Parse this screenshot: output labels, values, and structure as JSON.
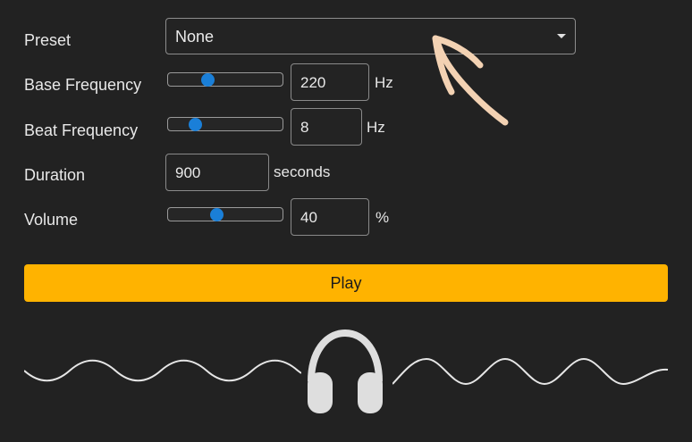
{
  "form": {
    "preset": {
      "label": "Preset",
      "value": "None"
    },
    "base_frequency": {
      "label": "Base Frequency",
      "value": "220",
      "unit": "Hz",
      "slider_fraction": 0.33
    },
    "beat_frequency": {
      "label": "Beat Frequency",
      "value": "8",
      "unit": "Hz",
      "slider_fraction": 0.2
    },
    "duration": {
      "label": "Duration",
      "value": "900",
      "unit": "seconds"
    },
    "volume": {
      "label": "Volume",
      "value": "40",
      "unit": "%",
      "slider_fraction": 0.42
    }
  },
  "play_button": {
    "label": "Play"
  },
  "colors": {
    "background": "#222222",
    "accent": "#ffb300",
    "slider_thumb": "#1a7fd8",
    "annotation": "#f3d2b3"
  },
  "icons": [
    "chevron-down-icon",
    "headphones-icon",
    "wave-decoration",
    "annotation-arrow"
  ]
}
